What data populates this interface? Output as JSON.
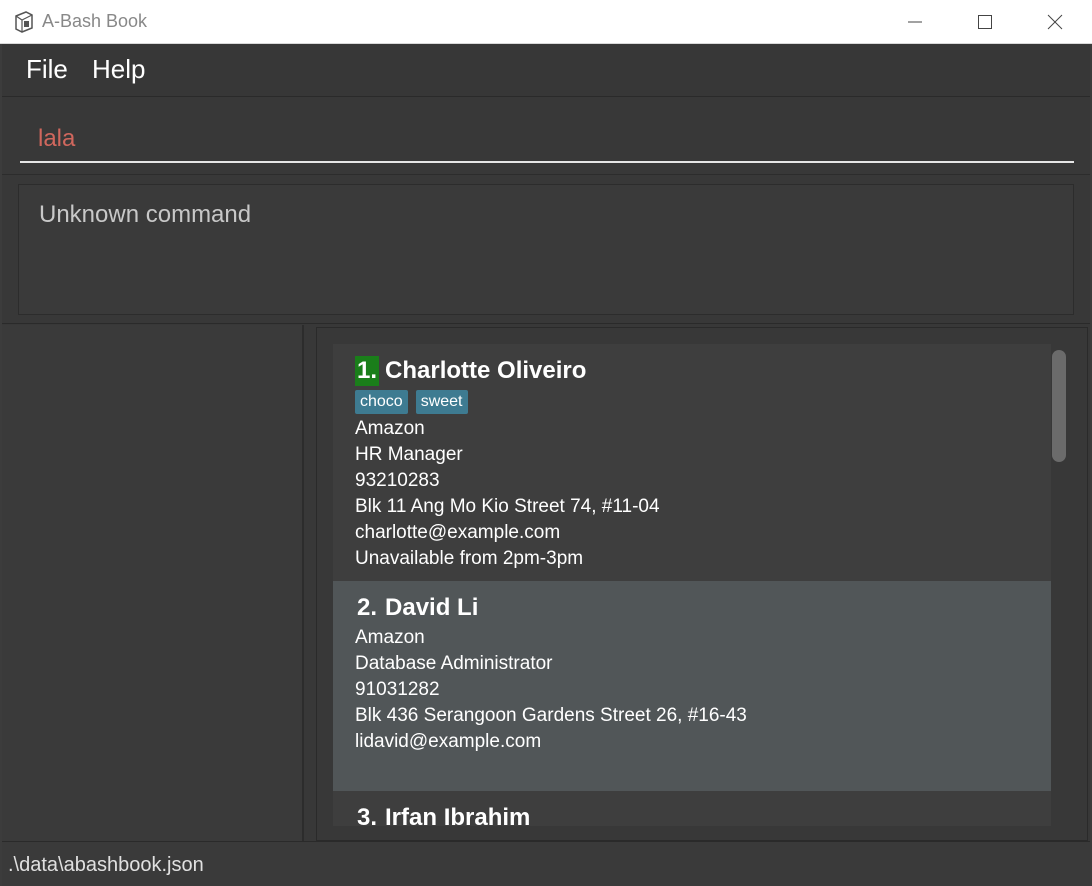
{
  "window": {
    "title": "A-Bash Book"
  },
  "menu": {
    "file": "File",
    "help": "Help"
  },
  "command": {
    "value": "lala"
  },
  "result": {
    "text": "Unknown command"
  },
  "persons": [
    {
      "index": "1.",
      "name": "Charlotte Oliveiro",
      "tags": [
        "choco",
        "sweet"
      ],
      "company": "Amazon",
      "role": "HR Manager",
      "phone": "93210283",
      "address": "Blk 11 Ang Mo Kio Street 74, #11-04",
      "email": "charlotte@example.com",
      "availability": "Unavailable from 2pm-3pm"
    },
    {
      "index": "2.",
      "name": "David Li",
      "company": "Amazon",
      "role": "Database Administrator",
      "phone": "91031282",
      "address": "Blk 436 Serangoon Gardens Street 26, #16-43",
      "email": "lidavid@example.com"
    },
    {
      "index": "3.",
      "name": "Irfan Ibrahim"
    }
  ],
  "status": {
    "path": ".\\data\\abashbook.json"
  },
  "colors": {
    "background": "#383838",
    "selected_card": "#515658",
    "tag": "#3e7b91",
    "index_highlight": "#1a7e1a",
    "command_text": "#d0675d"
  }
}
